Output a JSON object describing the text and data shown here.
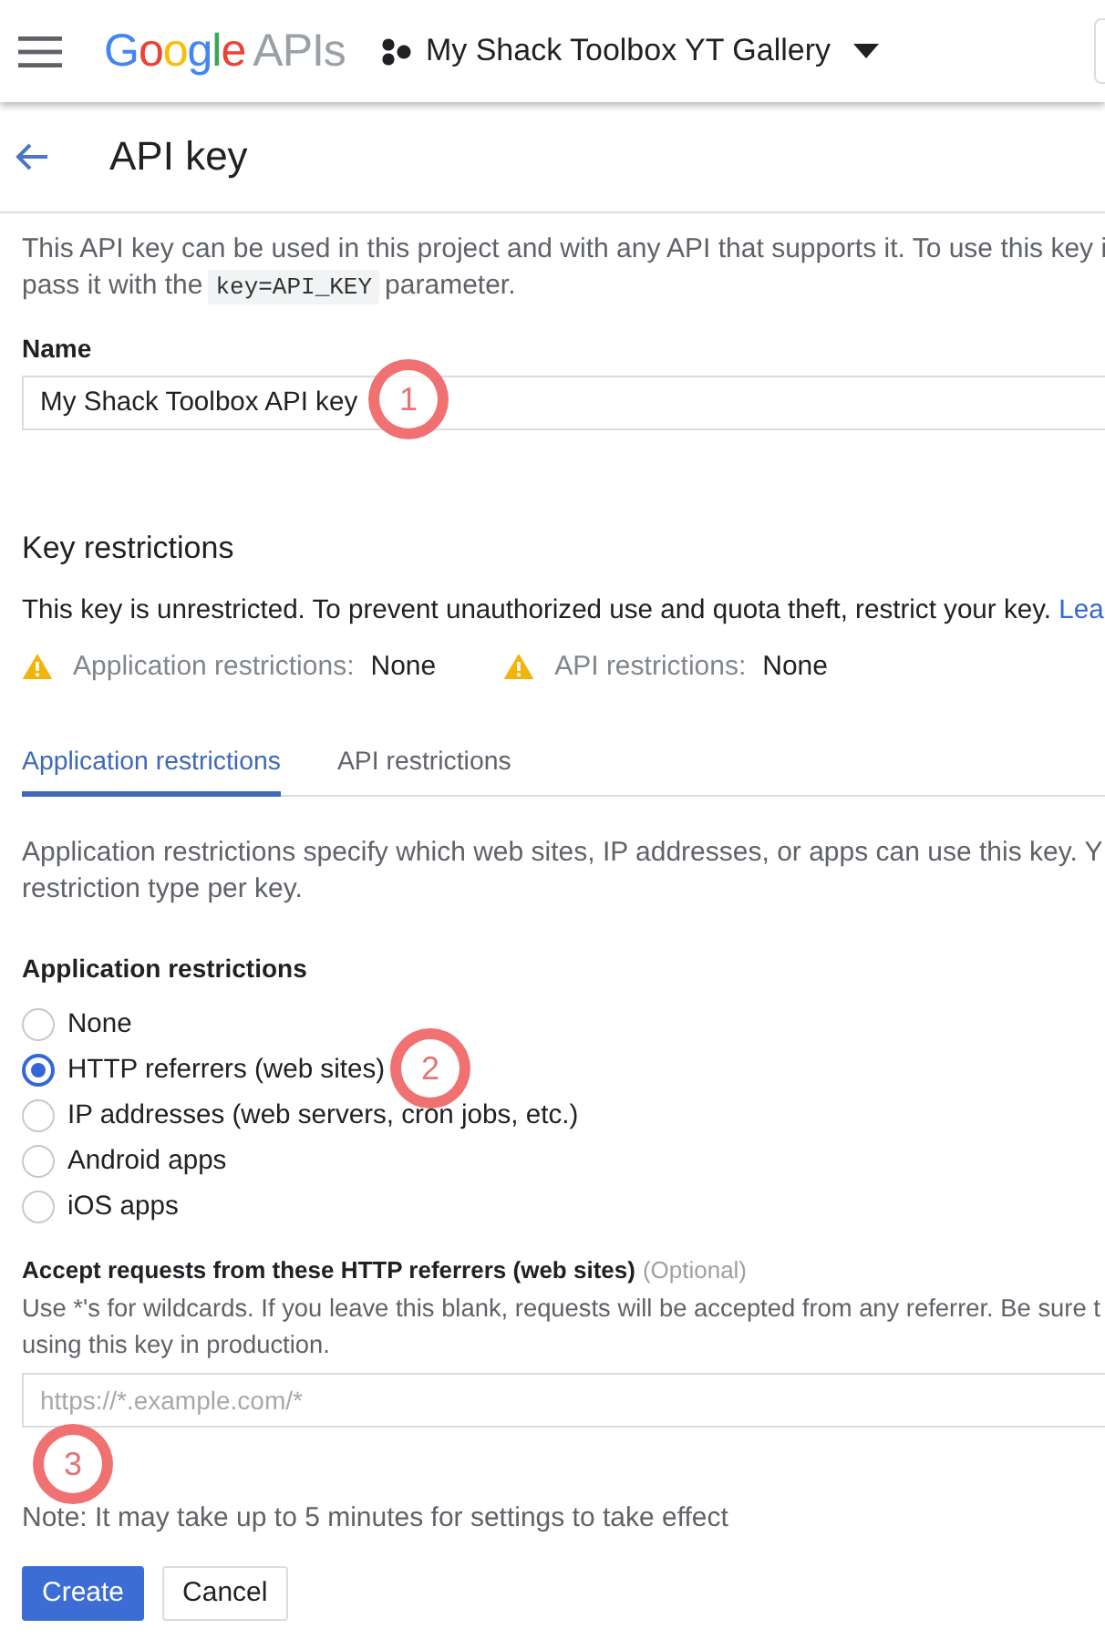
{
  "header": {
    "logo": {
      "brand": "Google",
      "product": "APIs"
    },
    "project": "My Shack Toolbox YT Gallery"
  },
  "page": {
    "title": "API key"
  },
  "intro": {
    "line_1": "This API key can be used in this project and with any API that supports it. To use this key i",
    "line_2_before": "pass it with the",
    "code": "key=API_KEY",
    "line_2_after": "parameter."
  },
  "name_field": {
    "label": "Name",
    "value": "My Shack Toolbox API key",
    "annotation": "1"
  },
  "key_restrictions": {
    "heading": "Key restrictions",
    "message": "This key is unrestricted. To prevent unauthorized use and quota theft, restrict your key.",
    "link": "Lea",
    "warnings": [
      {
        "label": "Application restrictions:",
        "value": "None"
      },
      {
        "label": "API restrictions:",
        "value": "None"
      }
    ]
  },
  "tabs": [
    {
      "label": "Application restrictions",
      "selected": true
    },
    {
      "label": "API restrictions",
      "selected": false
    }
  ],
  "application_restrictions": {
    "description_lines": [
      "Application restrictions specify which web sites, IP addresses, or apps can use this key. Y",
      "restriction type per key."
    ],
    "heading": "Application restrictions",
    "options": [
      {
        "label": "None",
        "selected": false
      },
      {
        "label": "HTTP referrers (web sites)",
        "selected": true,
        "annotation": "2"
      },
      {
        "label": "IP addresses (web servers, cron jobs, etc.)",
        "selected": false
      },
      {
        "label": "Android apps",
        "selected": false
      },
      {
        "label": "iOS apps",
        "selected": false
      }
    ]
  },
  "referrers": {
    "label": "Accept requests from these HTTP referrers (web sites)",
    "optional": "(Optional)",
    "help_lines": [
      "Use *'s for wildcards. If you leave this blank, requests will be accepted from any referrer. Be sure t",
      "using this key in production."
    ],
    "placeholder": "https://*.example.com/*"
  },
  "note": {
    "text": "Note: It may take up to 5 minutes for settings to take effect",
    "annotation": "3"
  },
  "buttons": [
    {
      "label": "Create",
      "kind": "primary"
    },
    {
      "label": "Cancel",
      "kind": "secondary"
    }
  ]
}
